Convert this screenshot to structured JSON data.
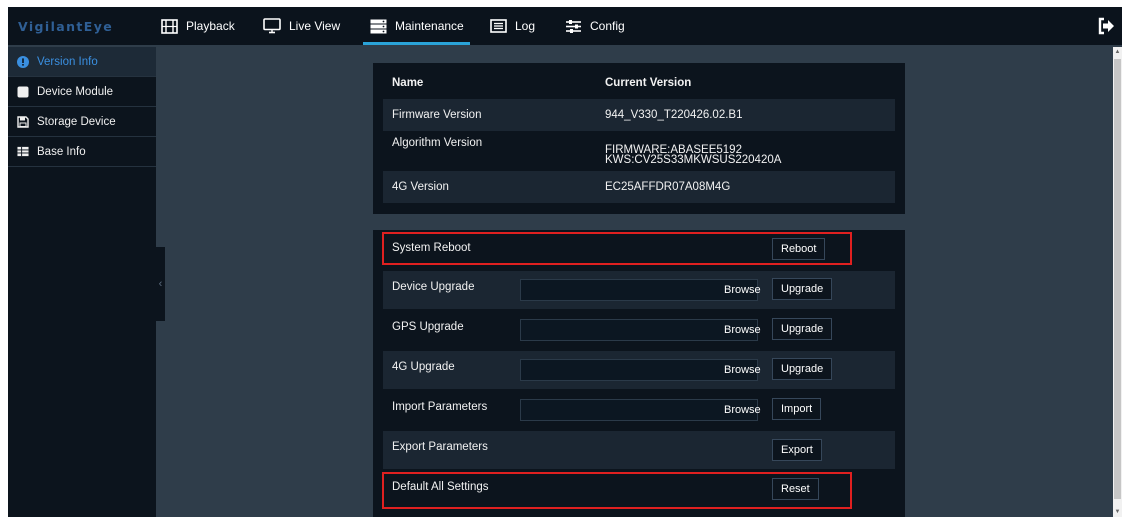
{
  "app": {
    "logo_text": "VigilantEye"
  },
  "nav": {
    "items": [
      {
        "label": "Playback",
        "icon": "film-icon"
      },
      {
        "label": "Live View",
        "icon": "monitor-icon"
      },
      {
        "label": "Maintenance",
        "icon": "server-icon",
        "active": true
      },
      {
        "label": "Log",
        "icon": "list-icon"
      },
      {
        "label": "Config",
        "icon": "sliders-icon"
      }
    ],
    "exit_icon": "logout-icon"
  },
  "sidebar": {
    "items": [
      {
        "label": "Version Info",
        "icon": "info-icon",
        "active": true
      },
      {
        "label": "Device Module",
        "icon": "module-icon"
      },
      {
        "label": "Storage Device",
        "icon": "floppy-icon"
      },
      {
        "label": "Base Info",
        "icon": "table-icon"
      }
    ],
    "collapse_glyph": "‹"
  },
  "version_table": {
    "headers": {
      "name": "Name",
      "version": "Current Version"
    },
    "rows": [
      {
        "name": "Firmware Version",
        "value": "944_V330_T220426.02.B1"
      },
      {
        "name": "Algorithm Version",
        "value_line1": "FIRMWARE:ABASEE5192",
        "value_line2": "KWS:CV25S33MKWSUS220420A"
      },
      {
        "name": "4G Version",
        "value": "EC25AFFDR07A08M4G"
      }
    ]
  },
  "maintenance": {
    "system_reboot": {
      "label": "System Reboot",
      "button": "Reboot"
    },
    "device_upgrade": {
      "label": "Device Upgrade",
      "browse": "Browse",
      "button": "Upgrade",
      "file_value": ""
    },
    "gps_upgrade": {
      "label": "GPS Upgrade",
      "browse": "Browse",
      "button": "Upgrade",
      "file_value": ""
    },
    "g4_upgrade": {
      "label": "4G Upgrade",
      "browse": "Browse",
      "button": "Upgrade",
      "file_value": ""
    },
    "import_params": {
      "label": "Import Parameters",
      "browse": "Browse",
      "button": "Import",
      "file_value": ""
    },
    "export_params": {
      "label": "Export Parameters",
      "button": "Export"
    },
    "default_all": {
      "label": "Default All Settings",
      "button": "Reset"
    }
  },
  "colors": {
    "accent": "#2aa3d8",
    "highlight_box": "#e02020",
    "logo": "#2f5f95",
    "sidebar_active_text": "#3a8fe0"
  }
}
